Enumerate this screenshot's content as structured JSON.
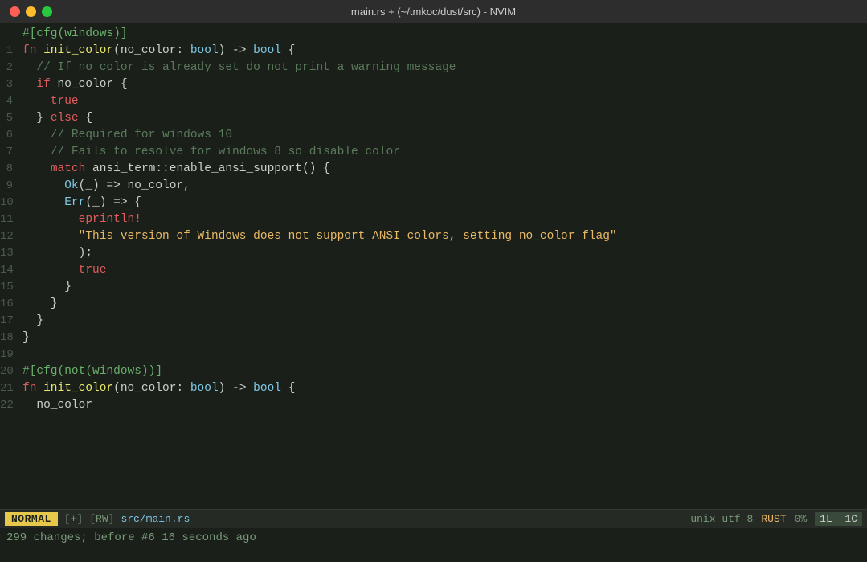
{
  "titleBar": {
    "title": "main.rs + (~/tmkoc/dust/src) - NVIM",
    "buttons": [
      "red",
      "yellow",
      "green"
    ]
  },
  "lines": [
    {
      "num": "",
      "tokens": [
        {
          "text": "#[cfg(windows)]",
          "class": "c-attr"
        }
      ]
    },
    {
      "num": "1",
      "tokens": [
        {
          "text": "fn ",
          "class": "c-keyword"
        },
        {
          "text": "init_color",
          "class": "c-fn-name"
        },
        {
          "text": "(no_color: ",
          "class": "c-punct"
        },
        {
          "text": "bool",
          "class": "c-type"
        },
        {
          "text": ") -> ",
          "class": "c-punct"
        },
        {
          "text": "bool",
          "class": "c-type"
        },
        {
          "text": " {",
          "class": "c-punct"
        }
      ]
    },
    {
      "num": "2",
      "tokens": [
        {
          "text": "// If no color is already set do not print a warning message",
          "class": "c-comment"
        }
      ]
    },
    {
      "num": "3",
      "tokens": [
        {
          "text": "if",
          "class": "c-keyword"
        },
        {
          "text": " no_color {",
          "class": "c-punct"
        }
      ]
    },
    {
      "num": "4",
      "tokens": [
        {
          "text": "true",
          "class": "c-bool"
        }
      ]
    },
    {
      "num": "5",
      "tokens": [
        {
          "text": "} ",
          "class": "c-punct"
        },
        {
          "text": "else",
          "class": "c-keyword"
        },
        {
          "text": " {",
          "class": "c-punct"
        }
      ]
    },
    {
      "num": "6",
      "tokens": [
        {
          "text": "// Required for windows 10",
          "class": "c-comment"
        }
      ]
    },
    {
      "num": "7",
      "tokens": [
        {
          "text": "// Fails to resolve for windows 8 so disable color",
          "class": "c-comment"
        }
      ]
    },
    {
      "num": "8",
      "tokens": [
        {
          "text": "match",
          "class": "c-keyword"
        },
        {
          "text": " ansi_term::enable_ansi_support() {",
          "class": "c-punct"
        }
      ]
    },
    {
      "num": "9",
      "tokens": [
        {
          "text": "Ok",
          "class": "c-variant"
        },
        {
          "text": "(_) => no_color,",
          "class": "c-punct"
        }
      ]
    },
    {
      "num": "10",
      "tokens": [
        {
          "text": "Err",
          "class": "c-variant"
        },
        {
          "text": "(_) => {",
          "class": "c-punct"
        }
      ]
    },
    {
      "num": "11",
      "tokens": [
        {
          "text": "eprintln!",
          "class": "c-macro"
        }
      ]
    },
    {
      "num": "12",
      "tokens": [
        {
          "text": "\"This version of Windows does not support ANSI colors, setting no_color flag\"",
          "class": "c-string"
        }
      ]
    },
    {
      "num": "13",
      "tokens": [
        {
          "text": ");",
          "class": "c-punct"
        }
      ]
    },
    {
      "num": "14",
      "tokens": [
        {
          "text": "true",
          "class": "c-bool"
        }
      ]
    },
    {
      "num": "15",
      "tokens": [
        {
          "text": "}",
          "class": "c-punct"
        }
      ]
    },
    {
      "num": "16",
      "tokens": [
        {
          "text": "}",
          "class": "c-punct"
        }
      ]
    },
    {
      "num": "17",
      "tokens": [
        {
          "text": "}",
          "class": "c-punct"
        }
      ]
    },
    {
      "num": "18",
      "tokens": [
        {
          "text": "}",
          "class": "c-punct"
        }
      ]
    },
    {
      "num": "19",
      "tokens": []
    },
    {
      "num": "20",
      "tokens": [
        {
          "text": "#[cfg(not(windows))]",
          "class": "c-attr"
        }
      ]
    },
    {
      "num": "21",
      "tokens": [
        {
          "text": "fn ",
          "class": "c-keyword"
        },
        {
          "text": "init_color",
          "class": "c-fn-name"
        },
        {
          "text": "(no_color: ",
          "class": "c-punct"
        },
        {
          "text": "bool",
          "class": "c-type"
        },
        {
          "text": ") -> ",
          "class": "c-punct"
        },
        {
          "text": "bool",
          "class": "c-type"
        },
        {
          "text": " {",
          "class": "c-punct"
        }
      ]
    },
    {
      "num": "22",
      "tokens": [
        {
          "text": "no_color",
          "class": "c-punct"
        }
      ]
    }
  ],
  "statusBar": {
    "mode": "NORMAL",
    "modified": "[+]",
    "rw": "[RW]",
    "filename": "src/main.rs",
    "encoding": "unix utf-8",
    "filetype": "RUST",
    "percent": "0%",
    "line": "1L",
    "col": "1C"
  },
  "cmdLine": {
    "text": "299 changes; before #6  16 seconds ago"
  },
  "lineIndents": {
    "1": 0,
    "2": 2,
    "3": 2,
    "4": 4,
    "5": 2,
    "6": 4,
    "7": 4,
    "8": 4,
    "9": 6,
    "10": 6,
    "11": 8,
    "12": 8,
    "13": 8,
    "14": 8,
    "15": 6,
    "16": 4,
    "17": 2,
    "18": 0,
    "20": 0,
    "21": 0,
    "22": 2
  }
}
